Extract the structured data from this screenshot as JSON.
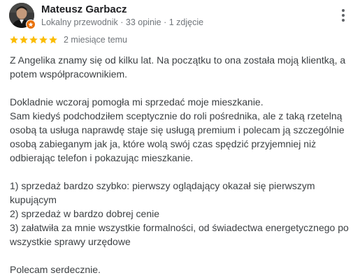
{
  "reviewer": {
    "name": "Mateusz Garbacz",
    "meta": "Lokalny przewodnik · 33 opinie · 1 zdjęcie",
    "avatar_icon": "profile-photo",
    "badge_icon": "local-guide-star-icon",
    "badge_color": "#e8710a"
  },
  "rating": {
    "stars": 5,
    "max": 5,
    "star_color": "#fbbc04",
    "date": "2 miesiące temu"
  },
  "more_icon": "more-vert-icon",
  "review": {
    "p1": "Z Angelika znamy się od kilku lat. Na początku to ona została moją klientką, a\npotem współpracownikiem.",
    "p2": "Dokladnie wczoraj pomogła mi sprzedać moje mieszkanie.\nSam kiedyś podchodziłem sceptycznie do roli pośrednika, ale z taką rzetelną\nosobą ta usługa naprawdę staje się usługą premium i polecam ją szczególnie\nosobą zabieganym jak ja, które wolą swój czas spędzić przyjemniej niż\nodbierając telefon i pokazując mieszkanie.",
    "p3": "1) sprzedaż bardzo szybko: pierwszy oglądający okazał się pierwszym\nkupującym\n2) sprzedaż w bardzo dobrej cenie\n3) załatwiła za mnie wszystkie formalności, od świadectwa energetycznego po\nwszystkie sprawy urzędowe",
    "p4": "Polecam serdecznie."
  }
}
